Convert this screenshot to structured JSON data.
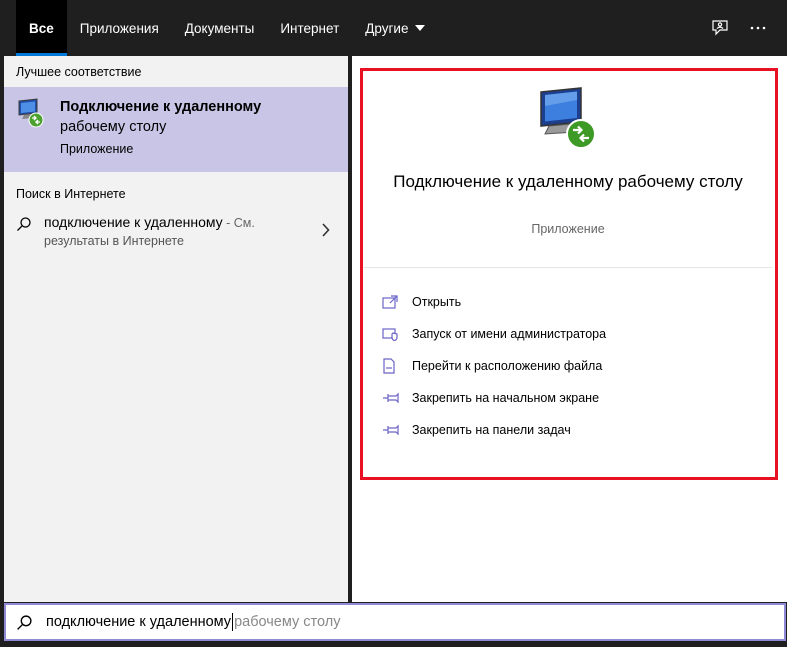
{
  "tabs": [
    {
      "label": "Все",
      "active": true
    },
    {
      "label": "Приложения",
      "active": false
    },
    {
      "label": "Документы",
      "active": false
    },
    {
      "label": "Интернет",
      "active": false
    },
    {
      "label": "Другие",
      "active": false
    }
  ],
  "top_icons": [
    "feedback-icon",
    "more-icon"
  ],
  "left": {
    "best_match_title": "Лучшее соответствие",
    "best_match": {
      "title_line1": "Подключение к удаленному",
      "title_line2": "рабочему столу",
      "type": "Приложение",
      "icon": "remote-desktop-icon"
    },
    "web_title": "Поиск в Интернете",
    "web_item": {
      "query": "подключение к удаленному",
      "suffix": " - См.",
      "line2": "результаты в Интернете",
      "icon": "search-icon"
    }
  },
  "right": {
    "app_title": "Подключение к удаленному рабочему столу",
    "app_type": "Приложение",
    "actions": [
      {
        "label": "Открыть",
        "icon": "open-icon"
      },
      {
        "label": "Запуск от имени администратора",
        "icon": "shield-icon"
      },
      {
        "label": "Перейти к расположению файла",
        "icon": "file-location-icon"
      },
      {
        "label": "Закрепить на начальном экране",
        "icon": "pin-icon"
      },
      {
        "label": "Закрепить на панели задач",
        "icon": "pin-icon"
      }
    ]
  },
  "search": {
    "typed": "подключение к удаленному",
    "suggestion": "рабочему столу"
  },
  "colors": {
    "accent": "#0078d7",
    "highlight": "#c9c5e6",
    "frame": "#e81123",
    "icon_purple": "#6b64c8"
  }
}
